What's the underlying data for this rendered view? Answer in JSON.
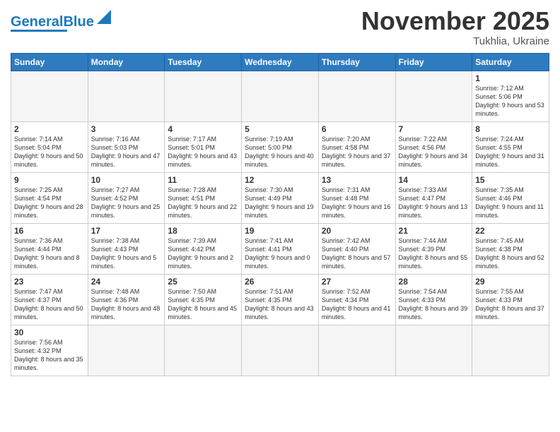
{
  "logo": {
    "text_general": "General",
    "text_blue": "Blue"
  },
  "header": {
    "month": "November 2025",
    "location": "Tukhlia, Ukraine"
  },
  "weekdays": [
    "Sunday",
    "Monday",
    "Tuesday",
    "Wednesday",
    "Thursday",
    "Friday",
    "Saturday"
  ],
  "weeks": [
    [
      {
        "day": "",
        "info": ""
      },
      {
        "day": "",
        "info": ""
      },
      {
        "day": "",
        "info": ""
      },
      {
        "day": "",
        "info": ""
      },
      {
        "day": "",
        "info": ""
      },
      {
        "day": "",
        "info": ""
      },
      {
        "day": "1",
        "info": "Sunrise: 7:12 AM\nSunset: 5:06 PM\nDaylight: 9 hours and 53 minutes."
      }
    ],
    [
      {
        "day": "2",
        "info": "Sunrise: 7:14 AM\nSunset: 5:04 PM\nDaylight: 9 hours and 50 minutes."
      },
      {
        "day": "3",
        "info": "Sunrise: 7:16 AM\nSunset: 5:03 PM\nDaylight: 9 hours and 47 minutes."
      },
      {
        "day": "4",
        "info": "Sunrise: 7:17 AM\nSunset: 5:01 PM\nDaylight: 9 hours and 43 minutes."
      },
      {
        "day": "5",
        "info": "Sunrise: 7:19 AM\nSunset: 5:00 PM\nDaylight: 9 hours and 40 minutes."
      },
      {
        "day": "6",
        "info": "Sunrise: 7:20 AM\nSunset: 4:58 PM\nDaylight: 9 hours and 37 minutes."
      },
      {
        "day": "7",
        "info": "Sunrise: 7:22 AM\nSunset: 4:56 PM\nDaylight: 9 hours and 34 minutes."
      },
      {
        "day": "8",
        "info": "Sunrise: 7:24 AM\nSunset: 4:55 PM\nDaylight: 9 hours and 31 minutes."
      }
    ],
    [
      {
        "day": "9",
        "info": "Sunrise: 7:25 AM\nSunset: 4:54 PM\nDaylight: 9 hours and 28 minutes."
      },
      {
        "day": "10",
        "info": "Sunrise: 7:27 AM\nSunset: 4:52 PM\nDaylight: 9 hours and 25 minutes."
      },
      {
        "day": "11",
        "info": "Sunrise: 7:28 AM\nSunset: 4:51 PM\nDaylight: 9 hours and 22 minutes."
      },
      {
        "day": "12",
        "info": "Sunrise: 7:30 AM\nSunset: 4:49 PM\nDaylight: 9 hours and 19 minutes."
      },
      {
        "day": "13",
        "info": "Sunrise: 7:31 AM\nSunset: 4:48 PM\nDaylight: 9 hours and 16 minutes."
      },
      {
        "day": "14",
        "info": "Sunrise: 7:33 AM\nSunset: 4:47 PM\nDaylight: 9 hours and 13 minutes."
      },
      {
        "day": "15",
        "info": "Sunrise: 7:35 AM\nSunset: 4:46 PM\nDaylight: 9 hours and 11 minutes."
      }
    ],
    [
      {
        "day": "16",
        "info": "Sunrise: 7:36 AM\nSunset: 4:44 PM\nDaylight: 9 hours and 8 minutes."
      },
      {
        "day": "17",
        "info": "Sunrise: 7:38 AM\nSunset: 4:43 PM\nDaylight: 9 hours and 5 minutes."
      },
      {
        "day": "18",
        "info": "Sunrise: 7:39 AM\nSunset: 4:42 PM\nDaylight: 9 hours and 2 minutes."
      },
      {
        "day": "19",
        "info": "Sunrise: 7:41 AM\nSunset: 4:41 PM\nDaylight: 9 hours and 0 minutes."
      },
      {
        "day": "20",
        "info": "Sunrise: 7:42 AM\nSunset: 4:40 PM\nDaylight: 8 hours and 57 minutes."
      },
      {
        "day": "21",
        "info": "Sunrise: 7:44 AM\nSunset: 4:39 PM\nDaylight: 8 hours and 55 minutes."
      },
      {
        "day": "22",
        "info": "Sunrise: 7:45 AM\nSunset: 4:38 PM\nDaylight: 8 hours and 52 minutes."
      }
    ],
    [
      {
        "day": "23",
        "info": "Sunrise: 7:47 AM\nSunset: 4:37 PM\nDaylight: 8 hours and 50 minutes."
      },
      {
        "day": "24",
        "info": "Sunrise: 7:48 AM\nSunset: 4:36 PM\nDaylight: 8 hours and 48 minutes."
      },
      {
        "day": "25",
        "info": "Sunrise: 7:50 AM\nSunset: 4:35 PM\nDaylight: 8 hours and 45 minutes."
      },
      {
        "day": "26",
        "info": "Sunrise: 7:51 AM\nSunset: 4:35 PM\nDaylight: 8 hours and 43 minutes."
      },
      {
        "day": "27",
        "info": "Sunrise: 7:52 AM\nSunset: 4:34 PM\nDaylight: 8 hours and 41 minutes."
      },
      {
        "day": "28",
        "info": "Sunrise: 7:54 AM\nSunset: 4:33 PM\nDaylight: 8 hours and 39 minutes."
      },
      {
        "day": "29",
        "info": "Sunrise: 7:55 AM\nSunset: 4:33 PM\nDaylight: 8 hours and 37 minutes."
      }
    ],
    [
      {
        "day": "30",
        "info": "Sunrise: 7:56 AM\nSunset: 4:32 PM\nDaylight: 8 hours and 35 minutes."
      },
      {
        "day": "",
        "info": ""
      },
      {
        "day": "",
        "info": ""
      },
      {
        "day": "",
        "info": ""
      },
      {
        "day": "",
        "info": ""
      },
      {
        "day": "",
        "info": ""
      },
      {
        "day": "",
        "info": ""
      }
    ]
  ]
}
